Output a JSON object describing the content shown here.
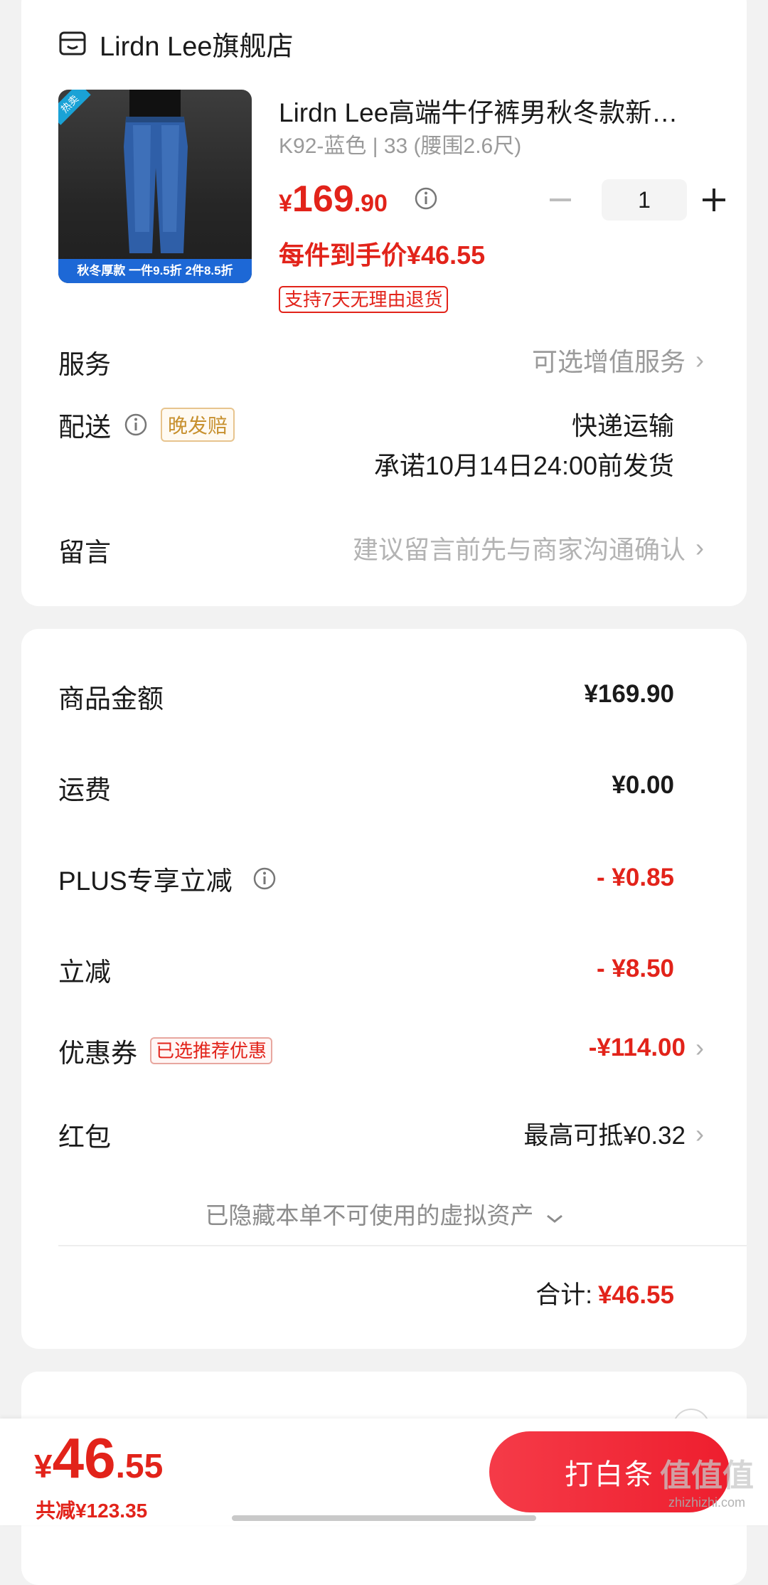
{
  "store": {
    "name": "Lirdn Lee旗舰店",
    "icon": "store-icon"
  },
  "product": {
    "title": "Lirdn Lee高端牛仔裤男秋冬款新…",
    "spec": "K92-蓝色 | 33 (腰围2.6尺)",
    "price_symbol": "¥",
    "price_int": "169",
    "price_dec": ".90",
    "quantity": "1",
    "final_price": "每件到手价¥46.55",
    "return_tag": "支持7天无理由退货",
    "image_banner": "秋冬厚款 一件9.5折 2件8.5折",
    "image_badge": "热卖"
  },
  "service": {
    "label": "服务",
    "value": "可选增值服务"
  },
  "delivery": {
    "label": "配送",
    "badge": "晚发赔",
    "method": "快递运输",
    "promise": "承诺10月14日24:00前发货"
  },
  "message": {
    "label": "留言",
    "placeholder": "建议留言前先与商家沟通确认"
  },
  "summary": {
    "goods_label": "商品金额",
    "goods_value": "¥169.90",
    "shipping_label": "运费",
    "shipping_value": "¥0.00",
    "plus_label": "PLUS专享立减",
    "plus_value": "- ¥0.85",
    "instant_label": "立减",
    "instant_value": "- ¥8.50",
    "coupon_label": "优惠券",
    "coupon_tag": "已选推荐优惠",
    "coupon_value": "-¥114.00",
    "redpacket_label": "红包",
    "redpacket_value": "最高可抵¥0.32",
    "hidden_assets": "已隐藏本单不可使用的虚拟资产",
    "total_label": "合计:",
    "total_value": "¥46.55"
  },
  "bottom_bar": {
    "price_symbol": "¥",
    "price_int": "46",
    "price_dec": ".55",
    "saved": "共减¥123.35",
    "pay_button": "打白条"
  },
  "watermark": {
    "text": "值值值",
    "sub": "zhizhizhi.com"
  },
  "colors": {
    "accent": "#e2231a",
    "button": "#f0283a"
  }
}
